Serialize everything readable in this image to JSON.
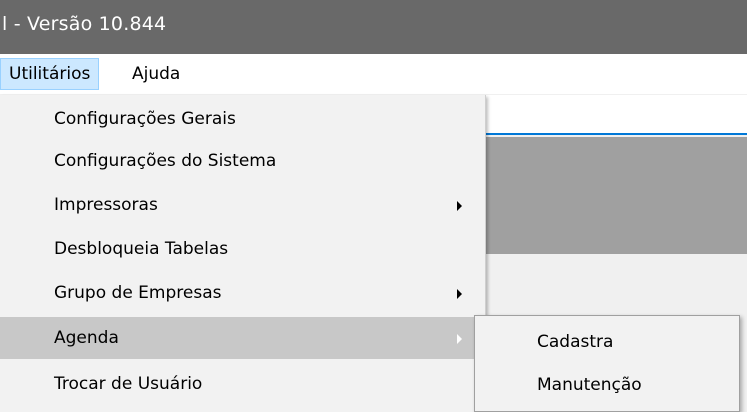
{
  "window": {
    "title": "l - Versão 10.844"
  },
  "menubar": {
    "items": [
      {
        "label": "Utilitários",
        "active": true
      },
      {
        "label": "Ajuda",
        "active": false
      }
    ]
  },
  "utilities_menu": {
    "items": [
      {
        "label": "Configurações Gerais",
        "has_submenu": false
      },
      {
        "label": "Configurações do Sistema",
        "has_submenu": false
      },
      {
        "label": "Impressoras",
        "has_submenu": true
      },
      {
        "label": "Desbloqueia Tabelas",
        "has_submenu": false
      },
      {
        "label": "Grupo de Empresas",
        "has_submenu": true
      },
      {
        "label": "Agenda",
        "has_submenu": true,
        "highlighted": true
      },
      {
        "label": "Trocar de Usuário",
        "has_submenu": false
      }
    ]
  },
  "agenda_submenu": {
    "items": [
      {
        "label": "Cadastra"
      },
      {
        "label": "Manutenção"
      }
    ]
  },
  "colors": {
    "titlebar_bg": "#696969",
    "menu_highlight": "#c8c8c8",
    "menubar_active": "#cce8ff",
    "focus_border": "#0078d7"
  }
}
